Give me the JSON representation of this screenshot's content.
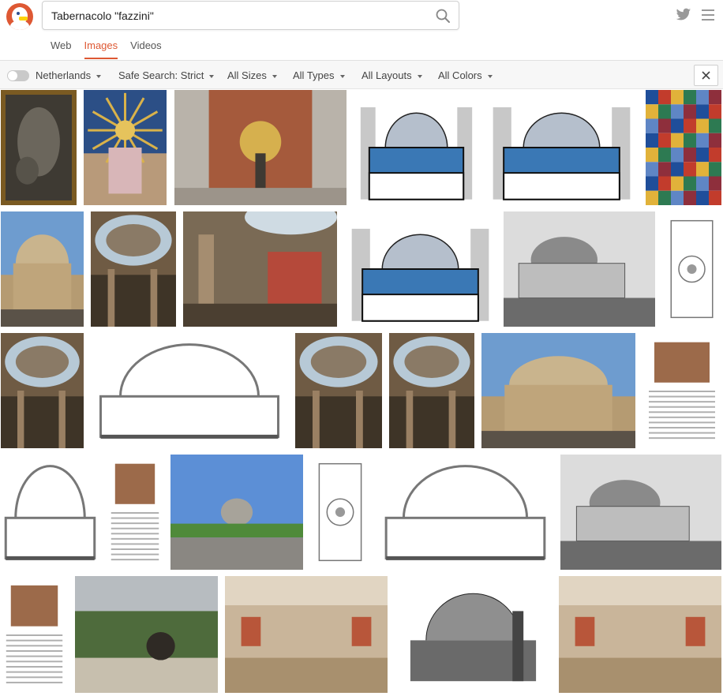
{
  "search": {
    "query": "Tabernacolo \"fazzini\""
  },
  "tabs": [
    {
      "label": "Web",
      "active": false
    },
    {
      "label": "Images",
      "active": true
    },
    {
      "label": "Videos",
      "active": false
    }
  ],
  "filters": {
    "region": "Netherlands",
    "safe_search": "Safe Search: Strict",
    "size": "All Sizes",
    "type": "All Types",
    "layout": "All Layouts",
    "color": "All Colors"
  },
  "colors": {
    "accent": "#de5833"
  },
  "results": [
    {
      "kind": "relief",
      "desc": "bronze relief panel"
    },
    {
      "kind": "altar",
      "desc": "golden sunburst tabernacle"
    },
    {
      "kind": "mosaic",
      "desc": "mosaic altar wall"
    },
    {
      "kind": "section-color",
      "desc": "colored section drawing"
    },
    {
      "kind": "section-color",
      "desc": "colored section drawing"
    },
    {
      "kind": "stained",
      "desc": "stained glass window"
    },
    {
      "kind": "dome-exterior",
      "desc": "dome exterior with car"
    },
    {
      "kind": "interior-dome",
      "desc": "interior view of dome"
    },
    {
      "kind": "interior-mosaic",
      "desc": "interior with mosaic"
    },
    {
      "kind": "section-color",
      "desc": "colored section drawing"
    },
    {
      "kind": "bw-photo",
      "desc": "black and white building"
    },
    {
      "kind": "plan",
      "desc": "floor plan drawing"
    },
    {
      "kind": "interior-dome",
      "desc": "looking up into dome"
    },
    {
      "kind": "section-line",
      "desc": "line section drawing"
    },
    {
      "kind": "interior-dome",
      "desc": "dome interior"
    },
    {
      "kind": "interior-dome",
      "desc": "interior balcony"
    },
    {
      "kind": "dome-exterior",
      "desc": "exterior facade"
    },
    {
      "kind": "document",
      "desc": "document page with image"
    },
    {
      "kind": "section-line",
      "desc": "line section drawing"
    },
    {
      "kind": "document",
      "desc": "document with photos"
    },
    {
      "kind": "landscape",
      "desc": "basilica across park"
    },
    {
      "kind": "plan",
      "desc": "floor plan"
    },
    {
      "kind": "section-line",
      "desc": "line section drawing"
    },
    {
      "kind": "bw-photo",
      "desc": "construction photo"
    },
    {
      "kind": "document",
      "desc": "document page"
    },
    {
      "kind": "garden",
      "desc": "garden with statue"
    },
    {
      "kind": "crypt",
      "desc": "crypt interior"
    },
    {
      "kind": "bw-drawing",
      "desc": "historic drawing"
    },
    {
      "kind": "crypt",
      "desc": "crypt chapel"
    }
  ]
}
